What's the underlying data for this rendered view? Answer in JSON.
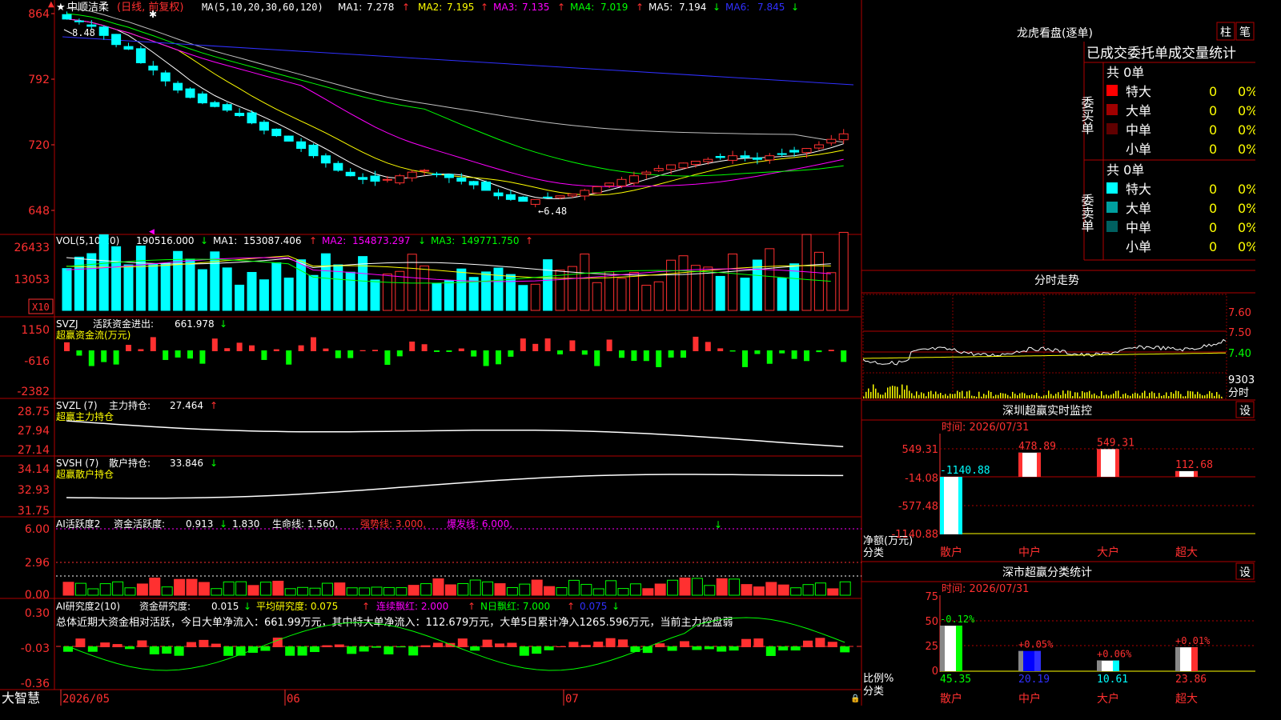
{
  "stock": {
    "name": "中顺洁柔",
    "mode": "(日线, 前复权)",
    "star": "★",
    "marker": "✱"
  },
  "colors": {
    "up": "#ff3030",
    "down": "#00ffff",
    "ma1": "#ffffff",
    "ma2": "#ffff00",
    "ma3": "#ff00ff",
    "ma4": "#00ff00",
    "ma5": "#c0c0c0",
    "ma6": "#3030ff",
    "grid": "#c00000",
    "frame": "#b00000",
    "orange": "#ff6020"
  },
  "main": {
    "ma_title": "MA(5,10,20,30,60,120)",
    "ma_items": [
      {
        "label": "MA1:",
        "value": "7.278",
        "arrow": "↑"
      },
      {
        "label": "MA2:",
        "value": "7.195",
        "arrow": "↑"
      },
      {
        "label": "MA3:",
        "value": "7.135",
        "arrow": "↑"
      },
      {
        "label": "MA4:",
        "value": "7.019",
        "arrow": "↑"
      },
      {
        "label": "MA5:",
        "value": "7.194",
        "arrow": "↓"
      },
      {
        "label": "MA6:",
        "value": "7.845",
        "arrow": "↓"
      }
    ],
    "y_ticks": [
      "864",
      "792",
      "720",
      "648"
    ],
    "high_label": "8.48",
    "low_label": "←6.48"
  },
  "vol": {
    "title": "VOL(5,10,20)",
    "value": "190516.000",
    "arrow": "↓",
    "items": [
      {
        "label": "MA1:",
        "value": "153087.406",
        "arrow": "↑"
      },
      {
        "label": "MA2:",
        "value": "154873.297",
        "arrow": "↓"
      },
      {
        "label": "MA3:",
        "value": "149771.750",
        "arrow": "↑"
      }
    ],
    "y_ticks": [
      "26433",
      "13053"
    ],
    "unit": "X10"
  },
  "svzj": {
    "title": "SVZJ",
    "label": "活跃资金进出:",
    "value": "661.978",
    "arrow": "↓",
    "sub": "超赢资金流(万元)",
    "y_ticks": [
      "1150",
      "-616",
      "-2382"
    ]
  },
  "svzl": {
    "title": "SVZL (7)",
    "label": "主力持仓:",
    "value": "27.464",
    "arrow": "↑",
    "sub": "超赢主力持仓",
    "y_ticks": [
      "28.75",
      "27.94",
      "27.14"
    ]
  },
  "svsh": {
    "title": "SVSH (7)",
    "label": "散户持仓:",
    "value": "33.846",
    "arrow": "↓",
    "sub": "超赢散户持仓",
    "y_ticks": [
      "34.14",
      "32.93",
      "31.75"
    ]
  },
  "ai1": {
    "title": "AI活跃度2",
    "label": "资金活跃度:",
    "value": "0.913",
    "arrow": "↓",
    "v2": "1.830",
    "life": "生命线: 1.560,",
    "strong": "强势线: 3.000,",
    "burst": "爆发线: 6.000,",
    "y_ticks": [
      "6.00",
      "2.96",
      "0.00"
    ]
  },
  "ai2": {
    "title": "AI研究度2(10)",
    "label": "资金研究度:",
    "value": "0.015",
    "arrow": "↓",
    "avg": "平均研究度: 0.075",
    "avg_arrow": "↑",
    "lianxu": "连续飘红: 2.000",
    "lianxu_arrow": "↑",
    "nri": "N日飘红: 7.000",
    "nri_arrow": "↑",
    "last": "0.075",
    "last_arrow": "↓",
    "summary": "总体近期大资金相对活跃，今日大单净流入：661.99万元，其中特大单净流入：112.679万元，大单5日累计净入1265.596万元，当前主力控盘弱",
    "y_ticks": [
      "0.30",
      "-0.03",
      "-0.36"
    ]
  },
  "bottom": {
    "logo": "大智慧",
    "dates": [
      "2026/05",
      "06",
      "07"
    ]
  },
  "panel_dragon": {
    "title": "龙虎看盘(逐单)",
    "tab1": "柱",
    "tab2": "笔",
    "tabs": "已成交委托单成交量统计",
    "buy": {
      "side": "委买单",
      "total": "共 0单",
      "rows": [
        {
          "label": "特大",
          "n": "0",
          "pct": "0%",
          "color": "#ff0000"
        },
        {
          "label": "大单",
          "n": "0",
          "pct": "0%",
          "color": "#a00000"
        },
        {
          "label": "中单",
          "n": "0",
          "pct": "0%",
          "color": "#600000"
        },
        {
          "label": "小单",
          "n": "0",
          "pct": "0%",
          "color": ""
        }
      ]
    },
    "sell": {
      "side": "委卖单",
      "total": "共 0单",
      "rows": [
        {
          "label": "特大",
          "n": "0",
          "pct": "0%",
          "color": "#00ffff"
        },
        {
          "label": "大单",
          "n": "0",
          "pct": "0%",
          "color": "#00a0a0"
        },
        {
          "label": "中单",
          "n": "0",
          "pct": "0%",
          "color": "#006060"
        },
        {
          "label": "小单",
          "n": "0",
          "pct": "0%",
          "color": ""
        }
      ]
    }
  },
  "panel_intraday": {
    "title": "分时走势",
    "prices": [
      "7.60",
      "7.50",
      "7.40"
    ],
    "vol": "9303",
    "unit": "分时"
  },
  "panel_sz": {
    "title": "深圳超赢实时监控",
    "settings": "设",
    "time": "时间: 2026/07/31",
    "y_ticks": [
      "549.31",
      "-14.08",
      "-577.48",
      "-1140.88"
    ],
    "y_label": "净额(万元)",
    "x_label": "分类",
    "bars": [
      {
        "cat": "散户",
        "value": -1140.88,
        "label": "-1140.88"
      },
      {
        "cat": "中户",
        "value": 478.89,
        "label": "478.89"
      },
      {
        "cat": "大户",
        "value": 549.31,
        "label": "549.31"
      },
      {
        "cat": "超大",
        "value": 112.68,
        "label": "112.68"
      }
    ]
  },
  "panel_cls": {
    "title": "深市超赢分类统计",
    "settings": "设",
    "time": "时间: 2026/07/31",
    "y_ticks": [
      "75",
      "50",
      "25",
      "0"
    ],
    "y_label": "比例%",
    "x_label": "分类",
    "bars": [
      {
        "cat": "散户",
        "value": 45.35,
        "label": "45.35",
        "delta": "-0.12%"
      },
      {
        "cat": "中户",
        "value": 20.19,
        "label": "20.19",
        "delta": "+0.05%"
      },
      {
        "cat": "大户",
        "value": 10.61,
        "label": "10.61",
        "delta": "+0.06%"
      },
      {
        "cat": "超大",
        "value": 23.86,
        "label": "23.86",
        "delta": "+0.01%"
      }
    ]
  },
  "chart_data": {
    "type": "candlestick",
    "title": "中顺洁柔 (日线, 前复权)",
    "high": 8.48,
    "low": 6.48,
    "closes": [
      8.58,
      8.55,
      8.5,
      8.4,
      8.3,
      8.25,
      8.1,
      8.02,
      7.9,
      7.8,
      7.72,
      7.66,
      7.62,
      7.58,
      7.52,
      7.44,
      7.36,
      7.3,
      7.24,
      7.16,
      7.08,
      7.0,
      6.92,
      6.86,
      6.82,
      6.8,
      6.82,
      6.86,
      6.9,
      6.92,
      6.88,
      6.84,
      6.8,
      6.76,
      6.7,
      6.64,
      6.6,
      6.58,
      6.6,
      6.62,
      6.64,
      6.66,
      6.7,
      6.74,
      6.78,
      6.82,
      6.86,
      6.9,
      6.94,
      6.98,
      7.0,
      7.02,
      7.04,
      7.06,
      7.08,
      7.06,
      7.04,
      7.08,
      7.1,
      7.12,
      7.16,
      7.2,
      7.26,
      7.32
    ]
  }
}
